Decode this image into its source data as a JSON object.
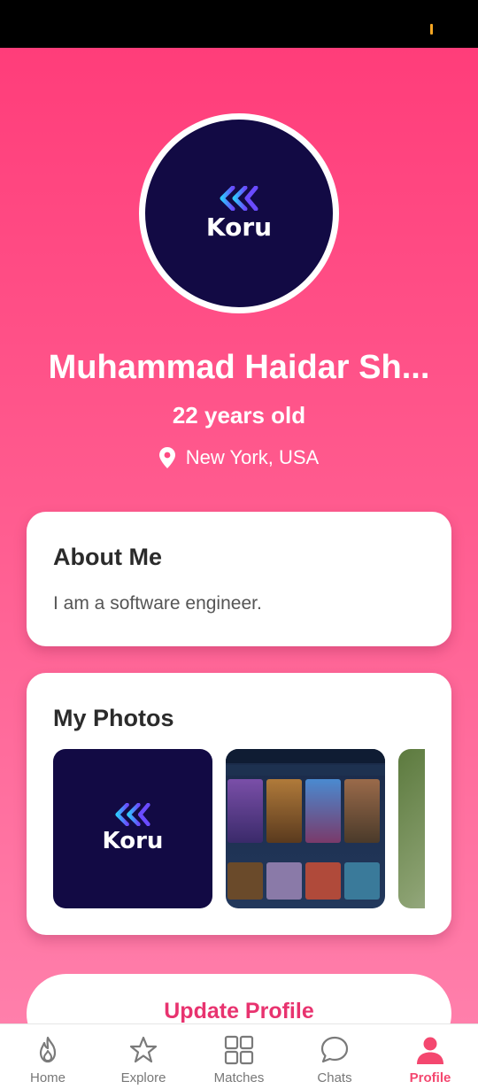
{
  "profile": {
    "avatar_logo_text": "Koru",
    "name": "Muhammad Haidar Sh...",
    "age": "22 years old",
    "location": "New York, USA"
  },
  "about": {
    "title": "About Me",
    "text": "I am a software engineer."
  },
  "photos": {
    "title": "My Photos",
    "items": [
      {
        "logo_text": "Koru"
      },
      {
        "description": "game-screenshot"
      },
      {
        "description": "photo-partial"
      }
    ]
  },
  "actions": {
    "update_label": "Update Profile"
  },
  "nav": {
    "items": [
      {
        "label": "Home",
        "icon": "flame-icon"
      },
      {
        "label": "Explore",
        "icon": "star-icon"
      },
      {
        "label": "Matches",
        "icon": "grid-icon"
      },
      {
        "label": "Chats",
        "icon": "chat-icon"
      },
      {
        "label": "Profile",
        "icon": "person-icon",
        "active": true
      }
    ]
  },
  "colors": {
    "brand_pink": "#ff3d7a",
    "active_nav": "#f4476f",
    "logo_bg": "#120a44"
  }
}
